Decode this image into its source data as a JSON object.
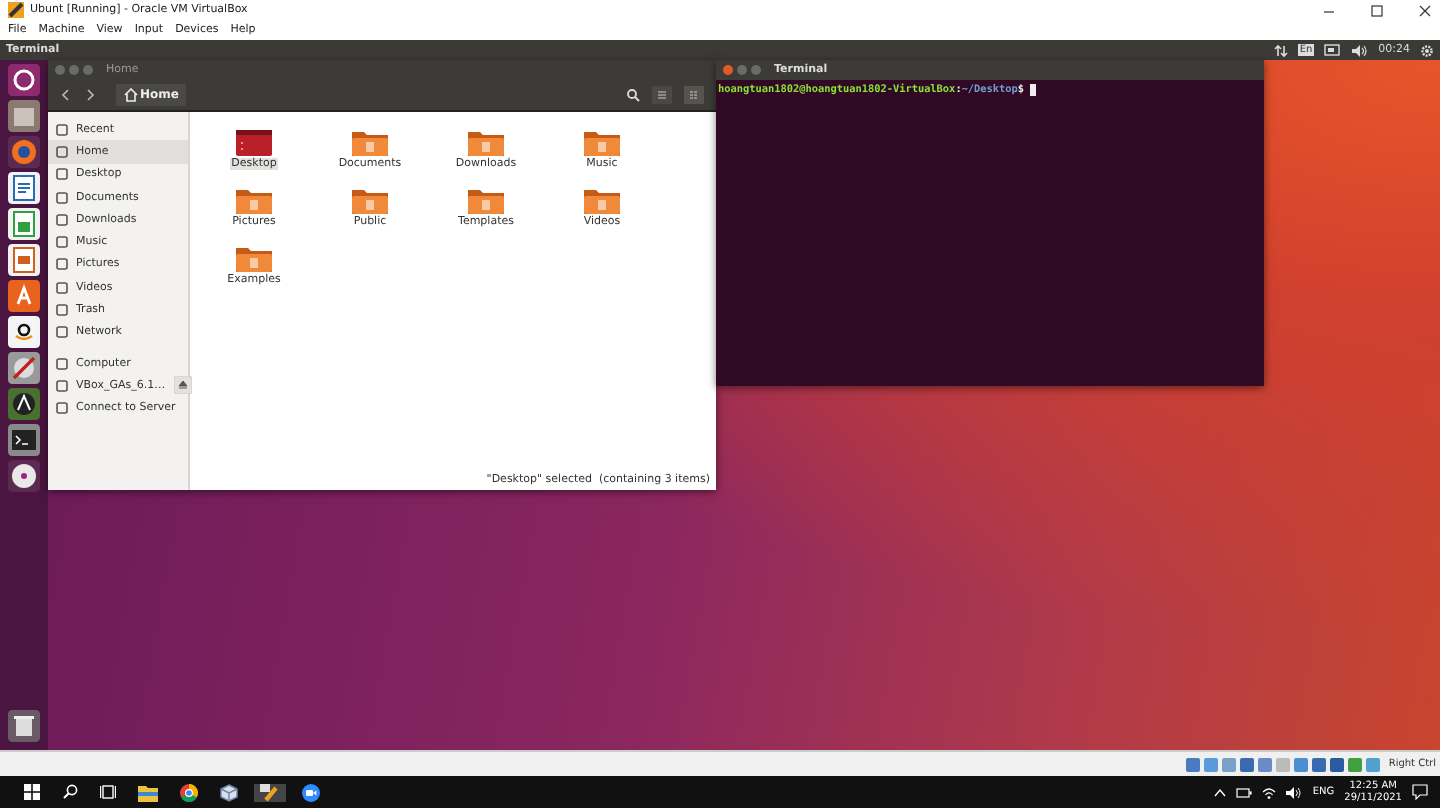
{
  "host_window": {
    "title": "Ubunt [Running] - Oracle VM VirtualBox",
    "menu": [
      "File",
      "Machine",
      "View",
      "Input",
      "Devices",
      "Help"
    ]
  },
  "top_bar": {
    "app_title": "Terminal",
    "keyboard": "En",
    "clock": "00:24"
  },
  "files_window": {
    "title": "Home",
    "path": "Home",
    "sidebar": [
      {
        "label": "Recent",
        "selected": false,
        "ejectable": false
      },
      {
        "label": "Home",
        "selected": true,
        "ejectable": false
      },
      {
        "label": "Desktop",
        "selected": false,
        "ejectable": false
      },
      {
        "label": "Documents",
        "selected": false,
        "ejectable": false
      },
      {
        "label": "Downloads",
        "selected": false,
        "ejectable": false
      },
      {
        "label": "Music",
        "selected": false,
        "ejectable": false
      },
      {
        "label": "Pictures",
        "selected": false,
        "ejectable": false
      },
      {
        "label": "Videos",
        "selected": false,
        "ejectable": false
      },
      {
        "label": "Trash",
        "selected": false,
        "ejectable": false
      },
      {
        "label": "Network",
        "selected": false,
        "ejectable": false
      },
      {
        "label": "Computer",
        "selected": false,
        "ejectable": false
      },
      {
        "label": "VBox_GAs_6.1…",
        "selected": false,
        "ejectable": true
      },
      {
        "label": "Connect to Server",
        "selected": false,
        "ejectable": false
      }
    ],
    "folders": [
      {
        "label": "Desktop",
        "kind": "desktop",
        "selected": true
      },
      {
        "label": "Documents",
        "kind": "folder",
        "selected": false
      },
      {
        "label": "Downloads",
        "kind": "folder",
        "selected": false
      },
      {
        "label": "Music",
        "kind": "folder",
        "selected": false
      },
      {
        "label": "Pictures",
        "kind": "folder",
        "selected": false
      },
      {
        "label": "Public",
        "kind": "folder",
        "selected": false
      },
      {
        "label": "Templates",
        "kind": "folder",
        "selected": false
      },
      {
        "label": "Videos",
        "kind": "folder",
        "selected": false
      },
      {
        "label": "Examples",
        "kind": "folder",
        "selected": false
      }
    ],
    "status": "\"Desktop\" selected  (containing 3 items)"
  },
  "terminal": {
    "title": "Terminal",
    "prompt": {
      "user_host": "hoangtuan1802@hoangtuan1802-VirtualBox",
      "separator": ":",
      "path": "~/Desktop",
      "symbol": "$"
    }
  },
  "vm_status_bar": {
    "host_key": "Right Ctrl"
  },
  "taskbar": {
    "keyboard": "ENG",
    "time": "12:25 AM",
    "date": "29/11/2021"
  }
}
